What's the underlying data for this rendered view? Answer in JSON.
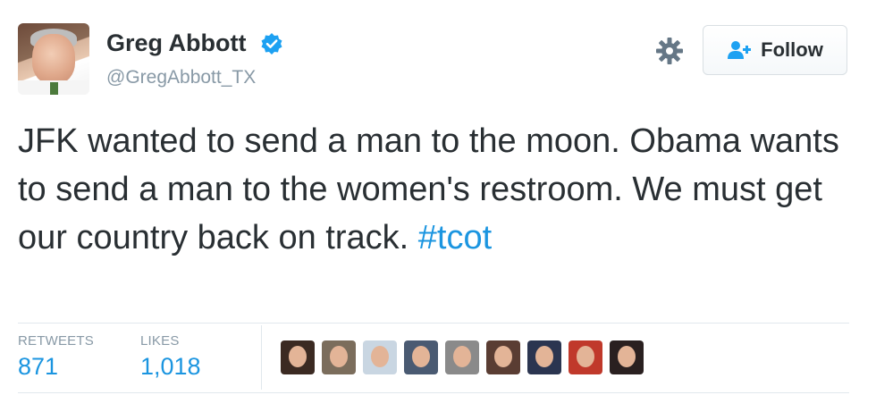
{
  "author": {
    "name": "Greg Abbott",
    "handle": "@GregAbbott_TX",
    "verified_icon": "verified-badge-icon"
  },
  "actions": {
    "settings_icon": "gear-icon",
    "follow_label": "Follow",
    "follow_icon": "add-user-icon"
  },
  "tweet": {
    "text": "JFK wanted to send a man to the moon. Obama wants to send a man to the women's restroom. We must get our country back on track.  ",
    "hashtag": "#tcot"
  },
  "stats": {
    "retweets_label": "RETWEETS",
    "retweets_value": "871",
    "likes_label": "LIKES",
    "likes_value": "1,018"
  },
  "likers": [
    {
      "name": "liker-avatar-1",
      "bg": "#3b2a22"
    },
    {
      "name": "liker-avatar-2",
      "bg": "#7b6d5c"
    },
    {
      "name": "liker-avatar-3",
      "bg": "#c9d6e2"
    },
    {
      "name": "liker-avatar-4",
      "bg": "#4a5a72"
    },
    {
      "name": "liker-avatar-5",
      "bg": "#8a8a8a"
    },
    {
      "name": "liker-avatar-6",
      "bg": "#5a3d33"
    },
    {
      "name": "liker-avatar-7",
      "bg": "#2b3550"
    },
    {
      "name": "liker-avatar-8",
      "bg": "#c0392b"
    },
    {
      "name": "liker-avatar-9",
      "bg": "#2a2020"
    }
  ],
  "colors": {
    "link": "#1b95e0",
    "muted": "#8899a6",
    "text": "#292f33",
    "verified": "#1da1f2"
  }
}
